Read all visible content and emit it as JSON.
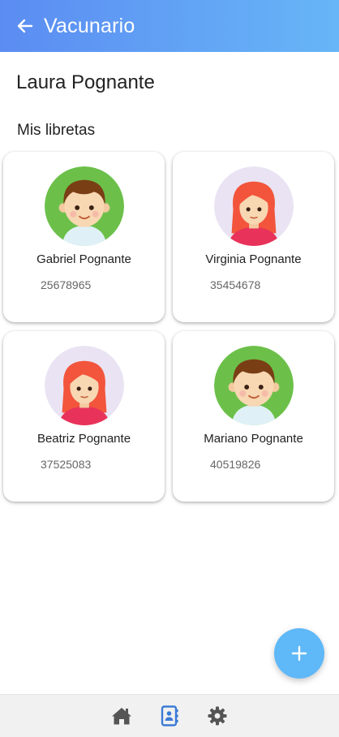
{
  "header": {
    "title": "Vacunario",
    "back_icon": "arrow-left-icon"
  },
  "user": {
    "name": "Laura Pognante"
  },
  "section": {
    "title": "Mis libretas"
  },
  "libretas": [
    {
      "name": "Gabriel Pognante",
      "document": "25678965",
      "avatar": "boy-avatar-icon"
    },
    {
      "name": "Virginia Pognante",
      "document": "35454678",
      "avatar": "girl-avatar-icon"
    },
    {
      "name": "Beatriz Pognante",
      "document": "37525083",
      "avatar": "girl-avatar-icon"
    },
    {
      "name": "Mariano Pognante",
      "document": "40519826",
      "avatar": "boy-avatar-icon"
    }
  ],
  "fab": {
    "icon": "plus-icon"
  },
  "nav": {
    "items": [
      {
        "icon": "home-icon",
        "active": false
      },
      {
        "icon": "contacts-book-icon",
        "active": true
      },
      {
        "icon": "gear-icon",
        "active": false
      }
    ]
  },
  "colors": {
    "header_start": "#5b8cf2",
    "header_end": "#67b6f7",
    "fab": "#5fb8f7",
    "nav_active": "#3a7bd5",
    "nav_inactive": "#555555"
  }
}
